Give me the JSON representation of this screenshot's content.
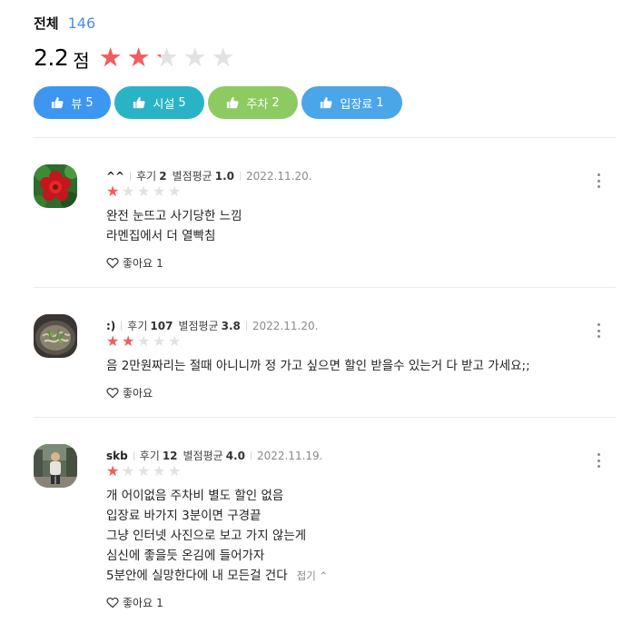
{
  "summary": {
    "total_label": "전체",
    "total_count": "146",
    "score": "2.2",
    "score_unit": "점",
    "stars_value": 2.2,
    "stars_max": 5
  },
  "chips": [
    {
      "name": "뷰",
      "count": "5",
      "color": "#3d96f0",
      "icon": "thumbs-up-icon"
    },
    {
      "name": "시설",
      "count": "5",
      "color": "#2ab3c6",
      "icon": "thumbs-up-icon"
    },
    {
      "name": "주차",
      "count": "2",
      "color": "#8dcb62",
      "icon": "thumbs-up-icon"
    },
    {
      "name": "입장료",
      "count": "1",
      "color": "#4aa6e8",
      "icon": "thumbs-up-icon"
    }
  ],
  "labels": {
    "review_count_label": "후기",
    "avg_label": "별점평균",
    "like_label": "좋아요",
    "collapse_label": "접기"
  },
  "reviews": [
    {
      "nickname": "^^",
      "review_count": "2",
      "avg_rating": "1.0",
      "date": "2022.11.20.",
      "rating": 1,
      "text": [
        "완전 눈뜨고 사기당한 느낌",
        "라멘집에서 더 열빡침"
      ],
      "likes": "1",
      "avatar_icon": "red-flower-avatar"
    },
    {
      "nickname": ":)",
      "review_count": "107",
      "avg_rating": "3.8",
      "date": "2022.11.20.",
      "rating": 2,
      "text": [
        "음 2만원짜리는 절때 아니니까 정 가고 싶으면 할인 받을수 있는거 다 받고 가세요;;"
      ],
      "likes": "",
      "avatar_icon": "food-bowl-avatar"
    },
    {
      "nickname": "skb",
      "review_count": "12",
      "avg_rating": "4.0",
      "date": "2022.11.19.",
      "rating": 1,
      "text": [
        "개 어이없음 주차비 별도 할인 없음",
        "입장료 바가지 3분이면 구경끝",
        "그냥 인터넷 사진으로 보고 가지 않는게",
        "심신에 좋을듯 온김에 들어가자",
        "5분안에 실망한다에 내 모든걸 건다"
      ],
      "likes": "1",
      "avatar_icon": "person-photo-avatar"
    }
  ],
  "colors": {
    "star_filled": "#f45b5b",
    "star_empty": "#e2e2e2",
    "accent_blue": "#4a8fe7"
  }
}
